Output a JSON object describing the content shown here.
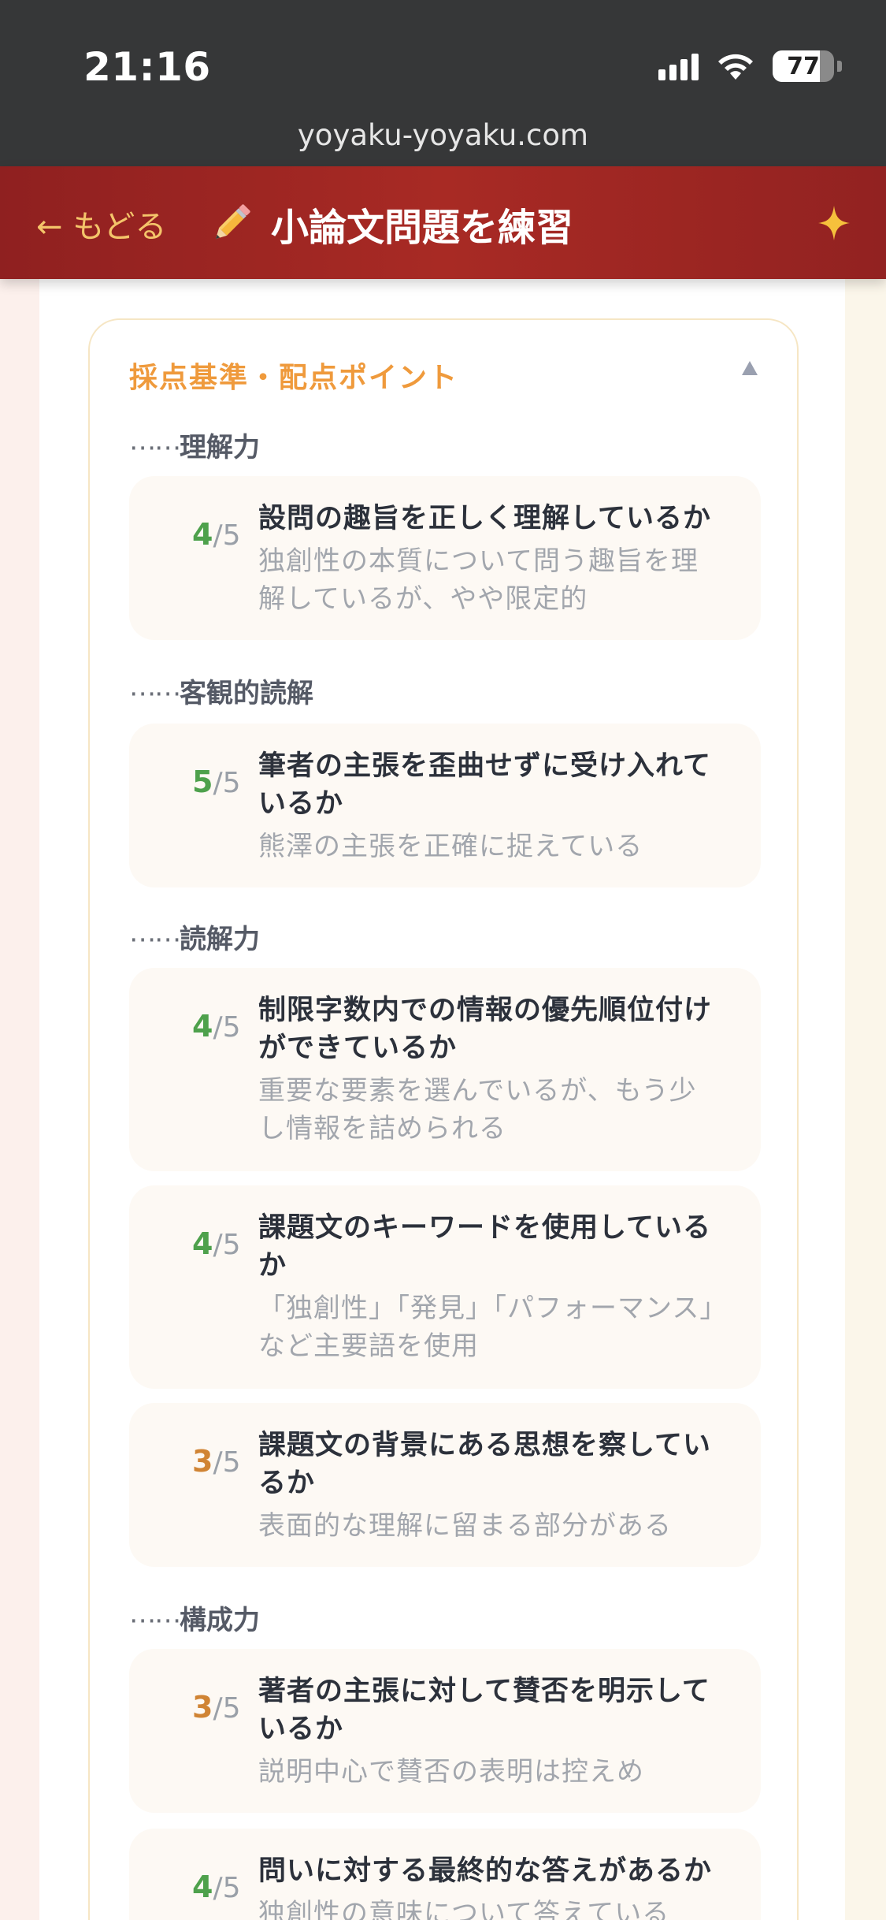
{
  "status_bar": {
    "time": "21:16",
    "battery": "77",
    "battery_level": 0.77
  },
  "browser": {
    "url": "yoyaku-yoyaku.com"
  },
  "header": {
    "back_label": "← もどる",
    "title": "小論文問題を練習"
  },
  "rubric": {
    "title": "採点基準・配点ポイント",
    "sections": [
      {
        "label": "理解力",
        "items": [
          {
            "score": "4",
            "max": "/5",
            "title": "設問の趣旨を正しく理解しているか",
            "desc": "独創性の本質について問う趣旨を理解しているが、やや限定的"
          }
        ]
      },
      {
        "label": "客観的読解",
        "items": [
          {
            "score": "5",
            "max": "/5",
            "title": "筆者の主張を歪曲せずに受け入れているか",
            "desc": "熊澤の主張を正確に捉えている"
          }
        ]
      },
      {
        "label": "読解力",
        "items": [
          {
            "score": "4",
            "max": "/5",
            "title": "制限字数内での情報の優先順位付けができているか",
            "desc": "重要な要素を選んでいるが、もう少し情報を詰められる"
          },
          {
            "score": "4",
            "max": "/5",
            "title": "課題文のキーワードを使用しているか",
            "desc": "「独創性」「発見」「パフォーマンス」など主要語を使用"
          },
          {
            "score": "3",
            "max": "/5",
            "title": "課題文の背景にある思想を察しているか",
            "desc": "表面的な理解に留まる部分がある"
          }
        ]
      },
      {
        "label": "構成力",
        "items": [
          {
            "score": "3",
            "max": "/5",
            "title": "著者の主張に対して賛否を明示しているか",
            "desc": "説明中心で賛否の表明は控えめ"
          },
          {
            "score": "4",
            "max": "/5",
            "title": "問いに対する最終的な答えがあるか",
            "desc": "独創性の意味について答えている"
          }
        ]
      }
    ]
  },
  "colors": {
    "header_red": "#a82a24",
    "accent_orange": "#ef9a3c",
    "score_green": "#4ea14c",
    "score_orange": "#d08434"
  }
}
